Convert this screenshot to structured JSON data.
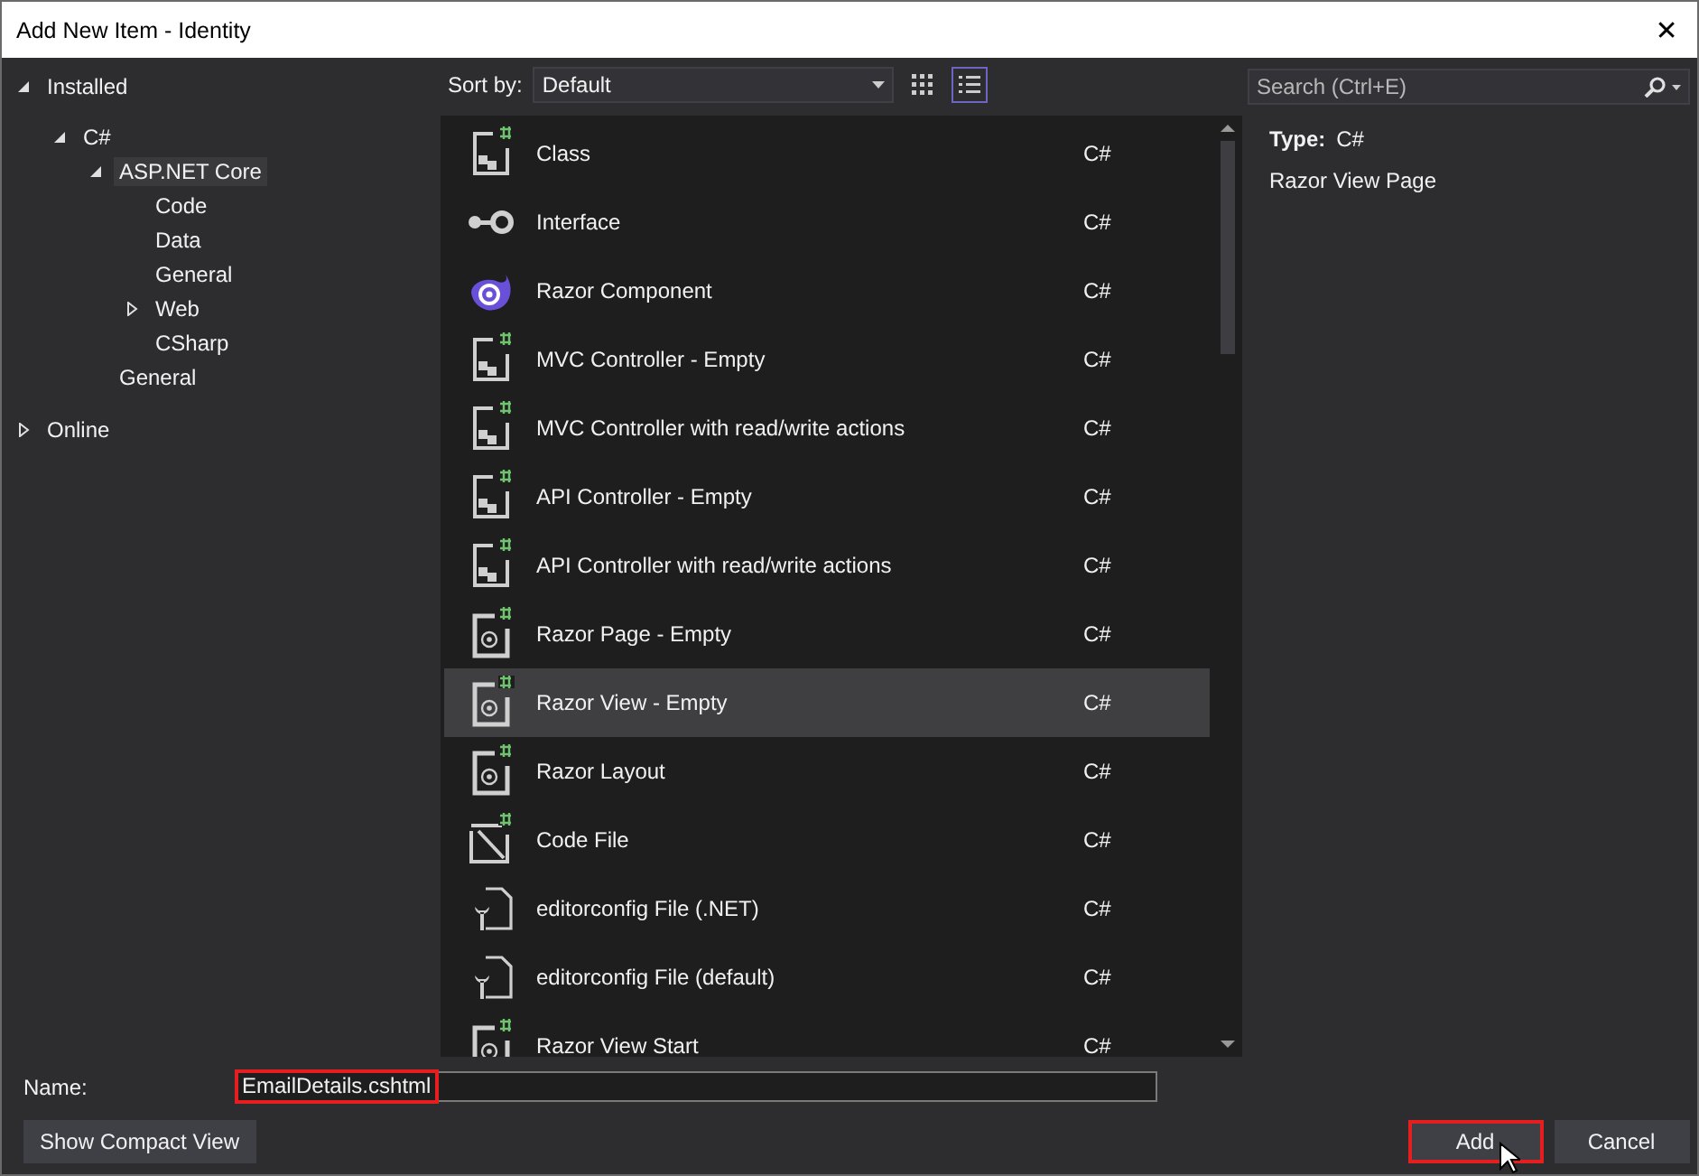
{
  "window": {
    "title": "Add New Item - Identity",
    "close": "✕"
  },
  "tree": [
    {
      "label": "Installed",
      "expanded": true,
      "selected": false,
      "children": [
        {
          "label": "C#",
          "expanded": true,
          "selected": false,
          "children": [
            {
              "label": "ASP.NET Core",
              "expanded": true,
              "selected": true,
              "children": [
                {
                  "label": "Code",
                  "selected": false
                },
                {
                  "label": "Data",
                  "selected": false
                },
                {
                  "label": "General",
                  "selected": false
                },
                {
                  "label": "Web",
                  "expanded": false,
                  "selected": false
                },
                {
                  "label": "CSharp",
                  "selected": false
                }
              ]
            },
            {
              "label": "General",
              "selected": false
            }
          ]
        }
      ]
    },
    {
      "label": "Online",
      "expanded": false,
      "selected": false
    }
  ],
  "toolbar": {
    "sort_label": "Sort by:",
    "sort_value": "Default",
    "view_modes": [
      {
        "kind": "grid",
        "selected": false
      },
      {
        "kind": "list",
        "selected": true
      }
    ]
  },
  "items": [
    {
      "name": "Class",
      "language": "C#",
      "kind": "csharp",
      "selected": false
    },
    {
      "name": "Interface",
      "language": "C#",
      "kind": "interface",
      "selected": false
    },
    {
      "name": "Razor Component",
      "language": "C#",
      "kind": "component",
      "selected": false
    },
    {
      "name": "MVC Controller - Empty",
      "language": "C#",
      "kind": "csharp",
      "selected": false
    },
    {
      "name": "MVC Controller with read/write actions",
      "language": "C#",
      "kind": "csharp",
      "selected": false
    },
    {
      "name": "API Controller - Empty",
      "language": "C#",
      "kind": "csharp",
      "selected": false
    },
    {
      "name": "API Controller with read/write actions",
      "language": "C#",
      "kind": "csharp",
      "selected": false
    },
    {
      "name": "Razor Page - Empty",
      "language": "C#",
      "kind": "razor",
      "selected": false
    },
    {
      "name": "Razor View - Empty",
      "language": "C#",
      "kind": "razor",
      "selected": true
    },
    {
      "name": "Razor Layout",
      "language": "C#",
      "kind": "razor",
      "selected": false
    },
    {
      "name": "Code File",
      "language": "C#",
      "kind": "code",
      "selected": false
    },
    {
      "name": "editorconfig File (.NET)",
      "language": "C#",
      "kind": "config",
      "selected": false
    },
    {
      "name": "editorconfig File (default)",
      "language": "C#",
      "kind": "config",
      "selected": false
    },
    {
      "name": "Razor View Start",
      "language": "C#",
      "kind": "razor",
      "selected": false
    }
  ],
  "search": {
    "placeholder": "Search (Ctrl+E)"
  },
  "details": {
    "type_label": "Type:",
    "type_value": "C#",
    "description": "Razor View Page"
  },
  "name_field": {
    "label": "Name:",
    "value": "EmailDetails.cshtml",
    "highlighted": true
  },
  "buttons": [
    {
      "label": "Show Compact View",
      "kind": "compact",
      "highlighted": false
    },
    {
      "label": "Add",
      "kind": "primary",
      "highlighted": true
    },
    {
      "label": "Cancel",
      "kind": "cancel",
      "highlighted": false
    }
  ]
}
